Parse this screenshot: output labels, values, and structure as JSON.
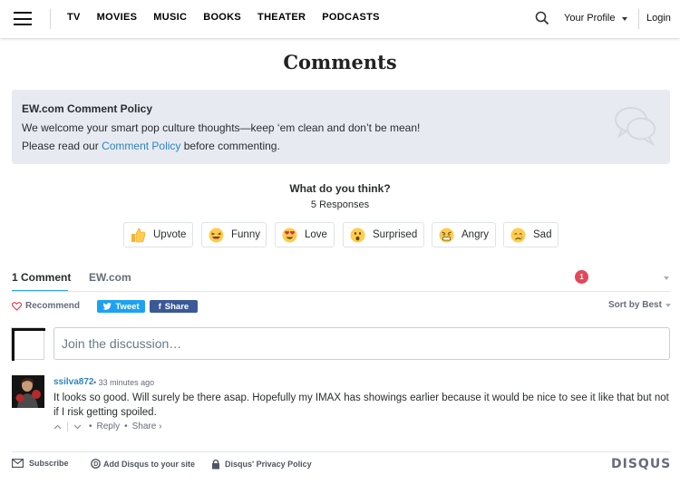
{
  "nav": {
    "links": [
      "TV",
      "MOVIES",
      "MUSIC",
      "BOOKS",
      "THEATER",
      "PODCASTS"
    ],
    "profile_label": "Your Profile",
    "login_label": "Login"
  },
  "page": {
    "heading": "Comments"
  },
  "policy": {
    "title": "EW.com Comment Policy",
    "line1": "We welcome your smart pop culture thoughts—keep ‘em clean and don’t be mean!",
    "line2_prefix": "Please read our ",
    "line2_link": "Comment Policy",
    "line2_suffix": " before commenting."
  },
  "reactions": {
    "prompt": "What do you think?",
    "count": "5 Responses",
    "items": [
      {
        "label": "Upvote",
        "icon": "thumbs-up-icon"
      },
      {
        "label": "Funny",
        "icon": "laughing-face-icon"
      },
      {
        "label": "Love",
        "icon": "heart-eyes-face-icon"
      },
      {
        "label": "Surprised",
        "icon": "surprised-face-icon"
      },
      {
        "label": "Angry",
        "icon": "angry-face-icon"
      },
      {
        "label": "Sad",
        "icon": "sad-face-icon"
      }
    ]
  },
  "tabs": {
    "comments": "1 Comment",
    "site": "EW.com",
    "notification_count": "1"
  },
  "toolbar": {
    "recommend": "Recommend",
    "tweet": "Tweet",
    "share": "Share",
    "sort": "Sort by Best"
  },
  "composer": {
    "placeholder": "Join the discussion…"
  },
  "comment": {
    "author": "ssilva872",
    "time": "• 33 minutes ago",
    "text": "It looks so good. Will surely be there asap. Hopefully my IMAX has showings earlier because it would be nice to see it like that but not if I risk getting spoiled.",
    "reply": "Reply",
    "share": "Share ›"
  },
  "footer": {
    "subscribe": "Subscribe",
    "add_disqus": "Add Disqus to your site",
    "privacy": "Disqus' Privacy Policy",
    "brand": "DISQUS"
  },
  "colors": {
    "link": "#2f84c1",
    "tab_accent": "#2e9fff",
    "badge": "#e3485a",
    "twitter": "#1da1f2",
    "facebook": "#3b5998",
    "policy_bg": "#e7ebf1"
  }
}
